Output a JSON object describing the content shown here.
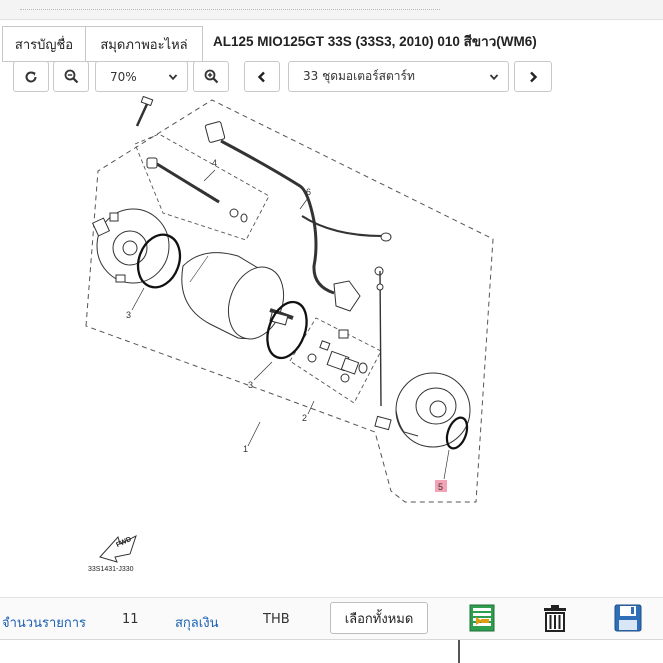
{
  "tabs": {
    "account_list": "สารบัญชื่อ",
    "parts_catalog": "สมุดภาพอะไหล่"
  },
  "model_title": "AL125 MIO125GT 33S (33S3, 2010) 010 สีขาว(WM6)",
  "toolbar": {
    "zoom_value": "70%",
    "section_value": "33 ชุดมอเตอร์สตาร์ท",
    "refresh_icon": "refresh-icon",
    "zoom_out_icon": "zoom-out-icon",
    "zoom_in_icon": "zoom-in-icon",
    "prev_icon": "chevron-left-icon",
    "next_icon": "chevron-right-icon"
  },
  "diagram": {
    "callouts": [
      "1",
      "2",
      "3",
      "3",
      "4",
      "5",
      "6"
    ],
    "highlighted_callout": "5",
    "highlight_color": "#f4a3b4",
    "fwd_label": "FWD",
    "drawing_code": "33S1431-J330"
  },
  "bottombar": {
    "item_count_label": "จำนวนรายการ",
    "item_count_value": "11",
    "currency_label": "สกุลเงิน",
    "currency_value": "THB",
    "select_all_label": "เลือกทั้งหมด",
    "icons": [
      "list-add-icon",
      "trash-icon",
      "save-icon"
    ],
    "label_color": "#1a5fb4"
  }
}
